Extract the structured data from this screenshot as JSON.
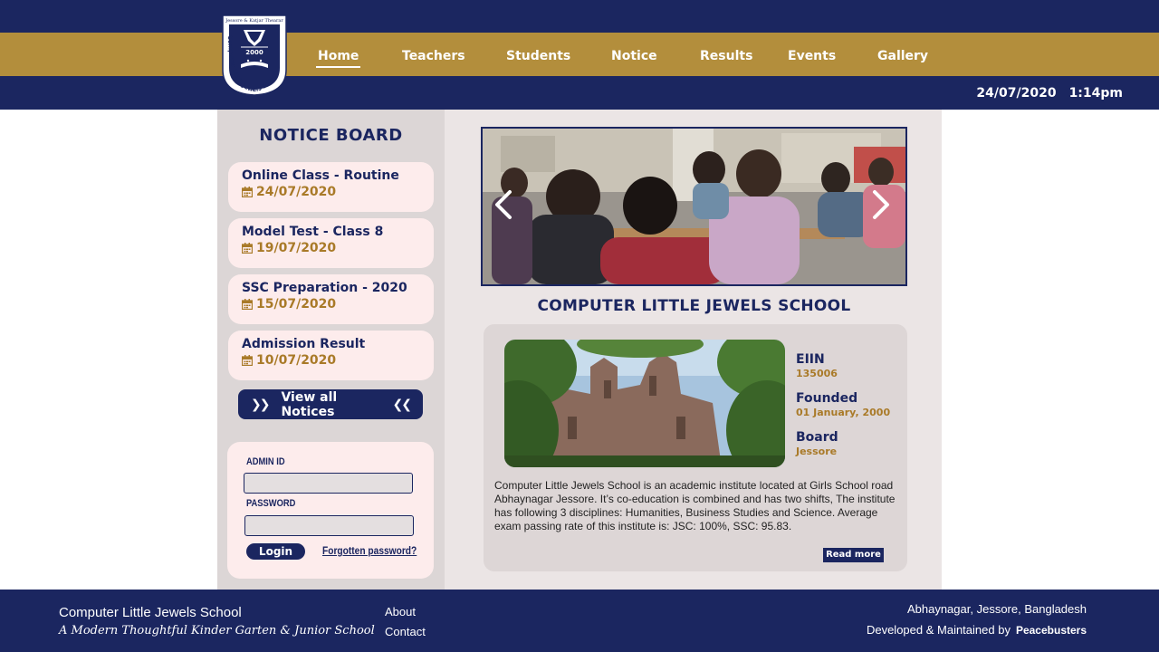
{
  "header": {
    "logo_alt": "Computer Little Jewels School logo",
    "logo_top_text": "Jessore & Katjar Thearar",
    "logo_year": "2000",
    "logo_ring_text": "Computer Little Jewels School",
    "date": "24/07/2020",
    "time": "1:14pm",
    "nav": [
      {
        "label": "Home"
      },
      {
        "label": "Teachers"
      },
      {
        "label": "Students"
      },
      {
        "label": "Notice"
      },
      {
        "label": "Results"
      },
      {
        "label": "Events"
      },
      {
        "label": "Gallery"
      }
    ]
  },
  "notice_board": {
    "title": "NOTICE BOARD",
    "items": [
      {
        "title": "Online Class - Routine",
        "date": "24/07/2020"
      },
      {
        "title": "Model Test - Class 8",
        "date": "19/07/2020"
      },
      {
        "title": "SSC Preparation - 2020",
        "date": "15/07/2020"
      },
      {
        "title": "Admission Result",
        "date": "10/07/2020"
      }
    ],
    "view_all_label": "View all Notices"
  },
  "login": {
    "admin_id_label": "ADMIN ID",
    "admin_id_value": "",
    "password_label": "PASSWORD",
    "password_value": "",
    "login_label": "Login",
    "forgot_label": "Forgotten password?"
  },
  "school": {
    "title": "COMPUTER LITTLE JEWELS SCHOOL",
    "facts": [
      {
        "label": "EIIN",
        "value": "135006"
      },
      {
        "label": "Founded",
        "value": "01 January, 2000"
      },
      {
        "label": "Board",
        "value": "Jessore"
      }
    ],
    "description": "Computer Little Jewels School is an academic institute located at Girls School road Abhaynagar Jessore. It’s co-education is combined and has two shifts, The institute has following 3 disciplines: Humanities, Business Studies and Science. Average exam passing rate of this institute is: JSC: 100%, SSC: 95.83.",
    "read_more_label": "Read more"
  },
  "footer": {
    "school_name": "Computer Little Jewels School",
    "tagline": "A Modern Thoughtful Kinder Garten & Junior School",
    "links": [
      {
        "label": "About"
      },
      {
        "label": "Contact"
      }
    ],
    "address": "Abhaynagar, Jessore, Bangladesh",
    "developed_by": "Developed & Maintained by",
    "developer": "Peacebusters"
  },
  "colors": {
    "navy": "#1b2660",
    "gold": "#b38e3c",
    "notice_bg": "#fdecec",
    "date_text": "#a97a28"
  }
}
